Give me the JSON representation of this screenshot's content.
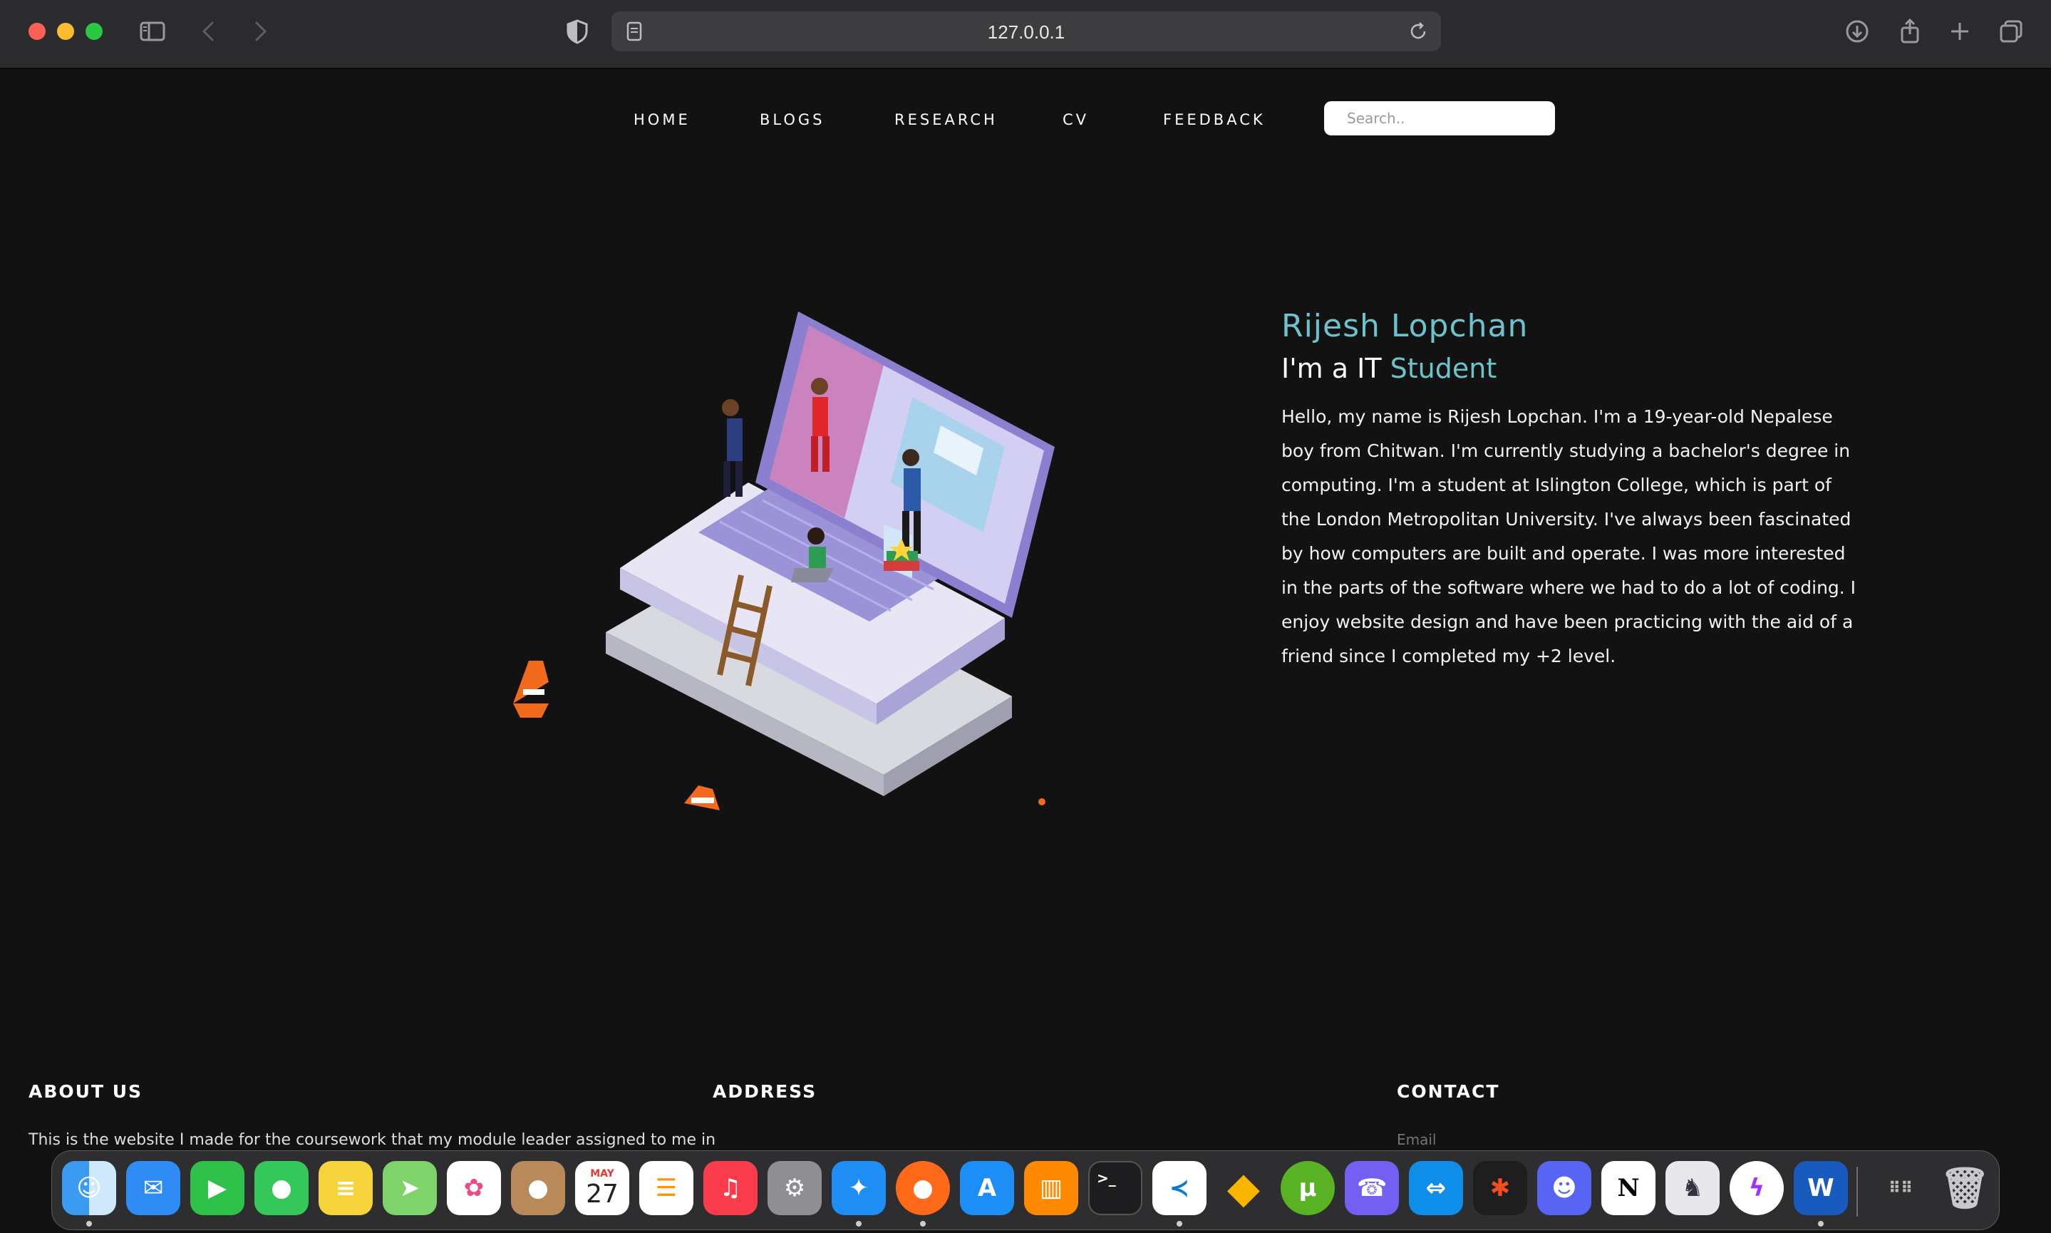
{
  "browser": {
    "url": "127.0.0.1"
  },
  "nav": {
    "links": [
      "HOME",
      "BLOGS",
      "RESEARCH",
      "CV",
      "FEEDBACK"
    ],
    "search_placeholder": "Search.."
  },
  "hero": {
    "name": "Rijesh Lopchan",
    "role_prefix": "I'm a IT",
    "role_accent": "Student",
    "bio": "Hello, my name is Rijesh Lopchan. I'm a 19-year-old Nepalese boy from Chitwan. I'm currently studying a bachelor's degree in computing. I'm a student at Islington College, which is part of the London Metropolitan University. I've always been fascinated by how computers are built and operate. I was more interested in the parts of the software where we had to do a lot of coding. I enjoy website design and have been practicing with the aid of a friend since I completed my +2 level."
  },
  "footer": {
    "about_title": "ABOUT US",
    "about_text": "This is the website I made for the coursework that my module leader assigned to me in",
    "address_title": "ADDRESS",
    "contact_title": "CONTACT",
    "email_placeholder": "Email"
  },
  "dock": {
    "calendar_month": "MAY",
    "calendar_day": "27",
    "apps": [
      "finder-icon",
      "mail-icon",
      "facetime-icon",
      "messages-icon",
      "notes-icon",
      "maps-icon",
      "photos-icon",
      "contacts-icon",
      "calendar-icon",
      "reminders-icon",
      "music-icon",
      "system-preferences-icon",
      "safari-icon",
      "firefox-icon",
      "app-store-icon",
      "books-icon",
      "terminal-icon",
      "vscode-icon",
      "sketch-icon",
      "utorrent-icon",
      "viber-icon",
      "teamviewer-icon",
      "figma-icon",
      "discord-icon",
      "notion-icon",
      "cyberduck-icon",
      "messenger-icon",
      "word-icon",
      "downloads-stack-icon",
      "trash-icon"
    ]
  },
  "colors": {
    "accent": "#6cc3cc",
    "background": "#121212"
  }
}
